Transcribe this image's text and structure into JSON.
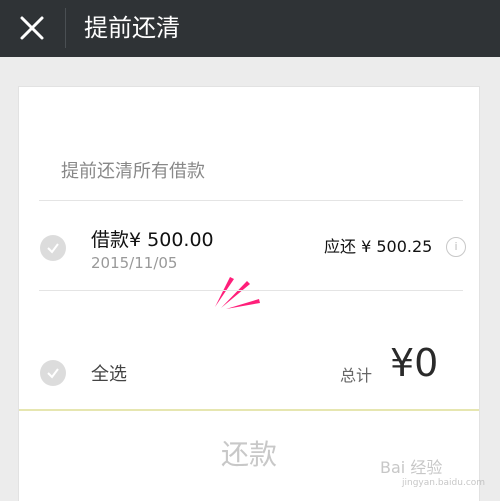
{
  "header": {
    "title": "提前还清",
    "close_icon": "close-icon"
  },
  "card": {
    "section_label": "提前还清所有借款",
    "loan": {
      "label": "借款",
      "amount": "¥ 500.00",
      "date": "2015/11/05",
      "due_label": "应还",
      "due_amount": "¥ 500.25",
      "info_icon": "i"
    },
    "footer": {
      "select_all": "全选",
      "total_label": "总计",
      "total_value": "¥0"
    },
    "repay_button": "还款"
  },
  "watermark": {
    "text": "Bai 经验",
    "sub": "jingyan.baidu.com"
  },
  "colors": {
    "header_bg": "#2f3336",
    "annotation": "#ff1f7a",
    "disabled_text": "#c8c8c8"
  }
}
